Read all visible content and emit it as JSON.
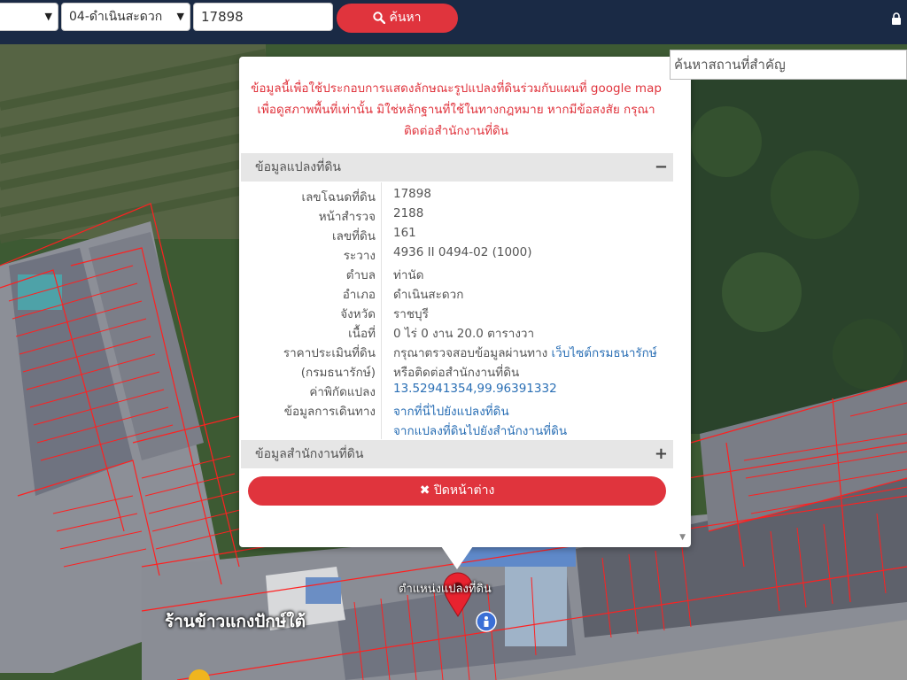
{
  "toolbar": {
    "district_select": "04-ดำเนินสะดวก",
    "parcel_input": "17898",
    "search_button": "ค้นหา"
  },
  "place_search": {
    "placeholder": "ค้นหาสถานที่สำคัญ"
  },
  "popup": {
    "notice": [
      "ข้อมูลนี้เพื่อใช้ประกอบการแสดงลักษณะรูปแปลงที่ดินร่วมกับแผนที่ google map",
      "เพื่อดูสภาพพื้นที่เท่านั้น มิใช่หลักฐานที่ใช้ในทางกฎหมาย หากมีข้อสงสัย กรุณา",
      "ติดต่อสำนักงานที่ดิน"
    ],
    "land_section": {
      "title": "ข้อมูลแปลงที่ดิน",
      "toggle": "−"
    },
    "rows": [
      {
        "key": "เลขโฉนดที่ดิน",
        "value": "17898"
      },
      {
        "key": "หน้าสำรวจ",
        "value": "2188"
      },
      {
        "key": "เลขที่ดิน",
        "value": "161"
      },
      {
        "key": "ระวาง",
        "value": "4936 II 0494-02 (1000)"
      },
      {
        "key": "ตำบล",
        "value": "ท่านัด"
      },
      {
        "key": "อำเภอ",
        "value": "ดำเนินสะดวก"
      },
      {
        "key": "จังหวัด",
        "value": "ราชบุรี"
      },
      {
        "key": "เนื้อที่",
        "value": "0 ไร่ 0 งาน 20.0 ตารางวา"
      }
    ],
    "price": {
      "key1": "ราคาประเมินที่ดิน",
      "key2": "(กรมธนารักษ์)",
      "text": "กรุณาตรวจสอบข้อมูลผ่านทาง ",
      "link": "เว็บไซต์กรมธนารักษ์",
      "text2": "หรือติดต่อสำนักงานที่ดิน"
    },
    "coords": {
      "key": "ค่าพิกัดแปลง",
      "value": "13.52941354,99.96391332"
    },
    "travel": {
      "key": "ข้อมูลการเดินทาง",
      "link1": "จากที่นี่ไปยังแปลงที่ดิน",
      "link2": "จากแปลงที่ดินไปยังสำนักงานที่ดิน"
    },
    "office_section": {
      "title": "ข้อมูลสำนักงานที่ดิน",
      "toggle": "+"
    },
    "close_button": "ปิดหน้าต่าง"
  },
  "map": {
    "pin_label": "ตำแหน่งแปลงที่ดิน",
    "shop_label": "ร้านข้าวแกงปักษ์ใต้"
  },
  "colors": {
    "accent": "#e0343d",
    "topbar": "#1a2a45",
    "link": "#2a6fb5"
  }
}
